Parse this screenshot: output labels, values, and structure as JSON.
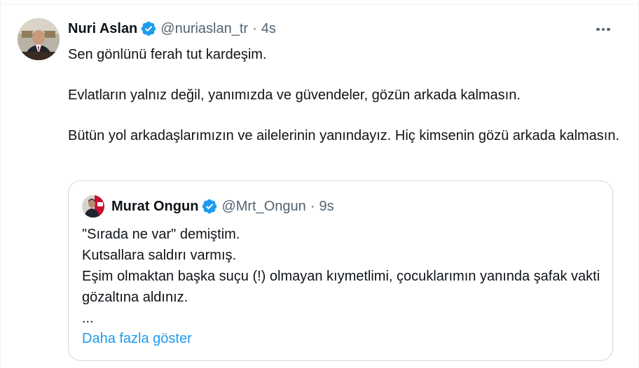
{
  "tweet": {
    "author_name": "Nuri Aslan",
    "handle": "@nuriaslan_tr",
    "separator": "·",
    "time": "4s",
    "avatar_icon": "profile-photo",
    "verified_icon": "verified-badge-icon",
    "more_icon": "more-horizontal-icon",
    "paragraphs": [
      "Sen gönlünü ferah tut kardeşim.",
      "Evlatların yalnız değil, yanımızda ve güvendeler, gözün arkada kalmasın.",
      "Bütün yol arkadaşlarımızın ve ailelerinin yanındayız. Hiç kimsenin gözü arkada kalmasın."
    ]
  },
  "quoted_tweet": {
    "author_name": "Murat Ongun",
    "handle": "@Mrt_Ongun",
    "separator": "·",
    "time": "9s",
    "lines": [
      "\"Sırada ne var\" demiştim.",
      "Kutsallara saldırı varmış.",
      "Eşim olmaktan başka suçu (!) olmayan kıymetlimi, çocuklarımın yanında şafak vakti gözaltına aldınız.",
      "..."
    ],
    "show_more_label": "Daha fazla göster"
  },
  "colors": {
    "text": "#0f1419",
    "secondary": "#536471",
    "link": "#1d9bf0",
    "verified": "#1d9bf0",
    "border": "#cfd9de"
  }
}
